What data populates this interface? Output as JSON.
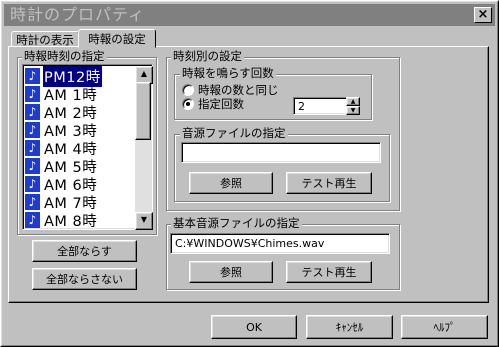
{
  "window": {
    "title": "時計のプロパティ",
    "close_glyph": "×"
  },
  "tabs": [
    {
      "label": "時計の表示"
    },
    {
      "label": "時報の設定"
    }
  ],
  "list_group": {
    "label": "時報時刻の指定"
  },
  "list": {
    "items": [
      {
        "label": "PM12時",
        "selected": true
      },
      {
        "label": "AM  1時"
      },
      {
        "label": "AM  2時"
      },
      {
        "label": "AM  3時"
      },
      {
        "label": "AM  4時"
      },
      {
        "label": "AM  5時"
      },
      {
        "label": "AM  6時"
      },
      {
        "label": "AM  7時"
      },
      {
        "label": "AM  8時"
      }
    ],
    "item_icon": "music-note-icon"
  },
  "buttons_left": {
    "all_on": "全部ならす",
    "all_off": "全部ならさない"
  },
  "time_settings": {
    "label": "時刻別の設定",
    "chime_count": {
      "label": "時報を鳴らす回数",
      "option_same": "時報の数と同じ",
      "option_specified": "指定回数",
      "count_value": "2"
    },
    "sound_file": {
      "label": "音源ファイルの指定",
      "value": "",
      "browse": "参照",
      "test": "テスト再生"
    }
  },
  "base_sound": {
    "label": "基本音源ファイルの指定",
    "value": "C:¥WINDOWS¥Chimes.wav",
    "browse": "参照",
    "test": "テスト再生"
  },
  "footer": {
    "ok": "OK",
    "cancel": "ｷｬﾝｾﾙ",
    "help": "ﾍﾙﾌﾟ"
  }
}
